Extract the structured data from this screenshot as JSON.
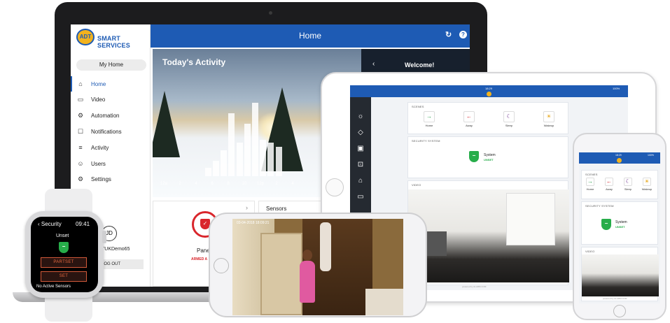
{
  "laptop": {
    "brand": "SMART SERVICES",
    "logo_text": "ADT",
    "title": "Home",
    "my_home": "My Home",
    "nav": [
      {
        "label": "Home",
        "icon": "home-icon",
        "glyph": "⌂"
      },
      {
        "label": "Video",
        "icon": "video-icon",
        "glyph": "▭"
      },
      {
        "label": "Automation",
        "icon": "automation-icon",
        "glyph": "⚙"
      },
      {
        "label": "Notifications",
        "icon": "bell-icon",
        "glyph": "☐"
      },
      {
        "label": "Activity",
        "icon": "activity-icon",
        "glyph": "≡"
      },
      {
        "label": "Users",
        "icon": "users-icon",
        "glyph": "☺"
      },
      {
        "label": "Settings",
        "icon": "gear-icon",
        "glyph": "⚙"
      }
    ],
    "todays_activity": "Today's Activity",
    "activity_ticks": [
      "12a",
      "2",
      "4",
      "6",
      "8",
      "10",
      "12p",
      "2",
      "4"
    ],
    "activity_levels": [
      0,
      0,
      0,
      0,
      0.08,
      0.15,
      0.25,
      0.6,
      0.32,
      0.5,
      0.7,
      0.35,
      0.32,
      0.28
    ],
    "welcome": "Welcome!",
    "panel_label": "Panel",
    "panel_status": "ARMED A",
    "sensors_label": "Sensors",
    "avatar_initials": "JD",
    "username": "TUKDemo65",
    "logout": "LOG OUT"
  },
  "tablet": {
    "time": "18:29",
    "battery": "100%",
    "scenes_label": "SCENES",
    "scenes": [
      {
        "name": "Home",
        "glyph": "→",
        "color": "#2aa14a"
      },
      {
        "name": "Away",
        "glyph": "←",
        "color": "#d6262c"
      },
      {
        "name": "Sleep",
        "glyph": "☾",
        "color": "#6a2a8a"
      },
      {
        "name": "Wakeup",
        "glyph": "☀",
        "color": "#e6a617"
      }
    ],
    "security_label": "SECURITY SYSTEM",
    "system_name": "System",
    "system_status": "UNSET",
    "video_label": "VIDEO",
    "footer": "powered by ALARM.COM"
  },
  "phone_right": {
    "time": "18:29",
    "battery": "100%",
    "scenes_label": "SCENES",
    "scenes": [
      {
        "name": "Home",
        "glyph": "→",
        "color": "#2aa14a"
      },
      {
        "name": "Away",
        "glyph": "←",
        "color": "#d6262c"
      },
      {
        "name": "Sleep",
        "glyph": "☾",
        "color": "#6a2a8a"
      },
      {
        "name": "Wakeup",
        "glyph": "☀",
        "color": "#e6a617"
      }
    ],
    "security_label": "SECURITY SYSTEM",
    "system_name": "System",
    "system_status": "UNSET",
    "video_label": "VIDEO",
    "footer": "powered by ALARM.COM"
  },
  "phone_center": {
    "timestamp": "03-04-2018 18:09:21"
  },
  "watch": {
    "title": "Security",
    "time": "09:41",
    "status": "Unset",
    "partset": "PARTSET",
    "set": "SET",
    "footer": "No Active Sensors"
  },
  "colors": {
    "brand_blue": "#1e5bb4",
    "armed_red": "#d9262c",
    "unset_green": "#27ad4a",
    "watch_orange": "#e8693f"
  }
}
